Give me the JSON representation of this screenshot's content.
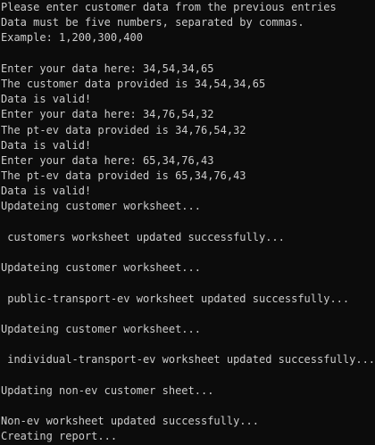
{
  "terminal": {
    "lines": [
      "Please enter customer data from the previous entries",
      "Data must be five numbers, separated by commas.",
      "Example: 1,200,300,400",
      "",
      "Enter your data here: 34,54,34,65",
      "The customer data provided is 34,54,34,65",
      "Data is valid!",
      "Enter your data here: 34,76,54,32",
      "The pt-ev data provided is 34,76,54,32",
      "Data is valid!",
      "Enter your data here: 65,34,76,43",
      "The pt-ev data provided is 65,34,76,43",
      "Data is valid!",
      "Updateing customer worksheet...",
      "",
      " customers worksheet updated successfully...",
      "",
      "Updateing customer worksheet...",
      "",
      " public-transport-ev worksheet updated successfully...",
      "",
      "Updateing customer worksheet...",
      "",
      " individual-transport-ev worksheet updated successfully...",
      "",
      "Updating non-ev customer sheet...",
      "",
      "Non-ev worksheet updated successfully...",
      "Creating report..."
    ]
  }
}
